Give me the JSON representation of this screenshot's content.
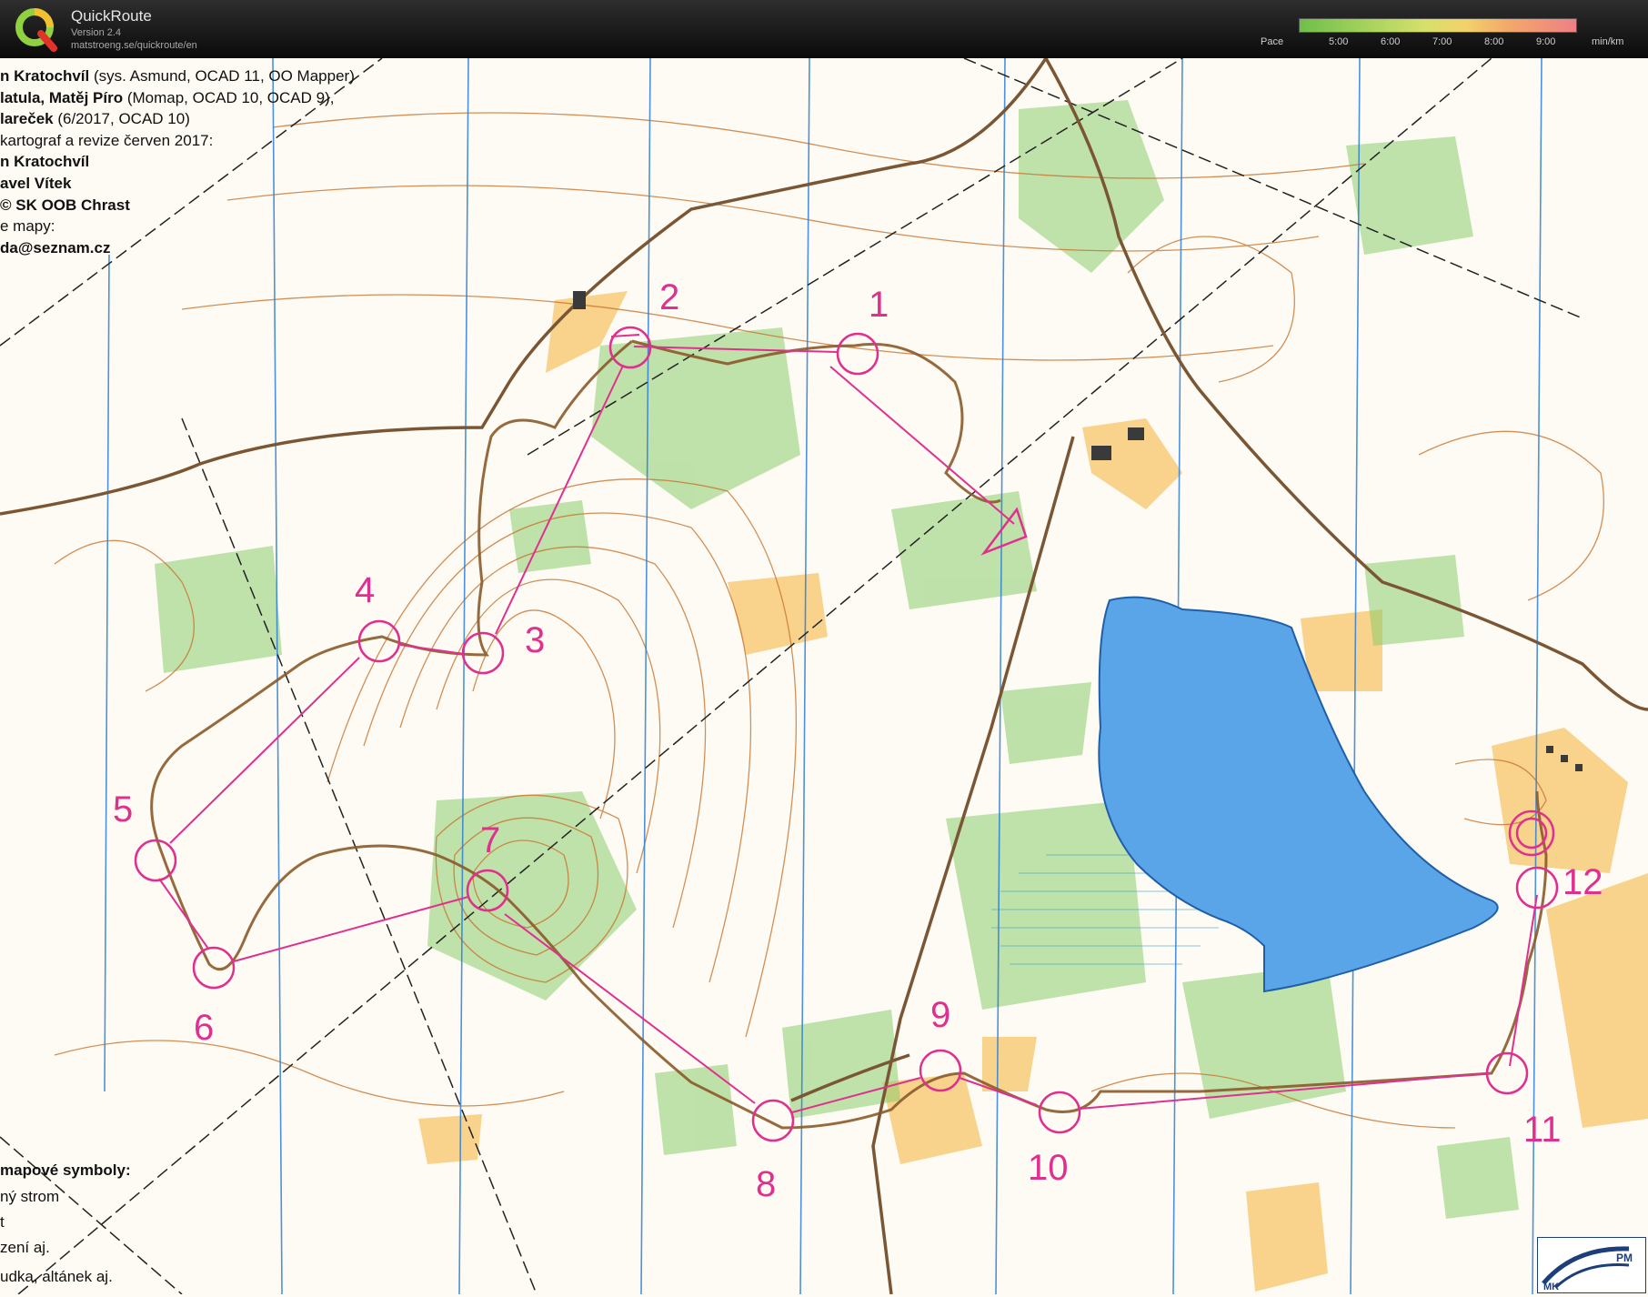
{
  "app": {
    "name": "QuickRoute",
    "version": "Version 2.4",
    "url": "matstroeng.se/quickroute/en"
  },
  "pace_scale": {
    "label": "Pace",
    "ticks": [
      "5:00",
      "6:00",
      "7:00",
      "8:00",
      "9:00"
    ],
    "unit": "min/km",
    "colors": [
      "#6fbf4a",
      "#a7d35d",
      "#d6e06a",
      "#f2d26a",
      "#f3a96a",
      "#ef7f85"
    ]
  },
  "credits": {
    "line1_name": "n Kratochvíl",
    "line1_rest": " (sys. Asmund, OCAD 11, OO  Mapper)",
    "line2_name": "latula, Matěj Píro",
    "line2_rest": " (Momap, OCAD 10, OCAD 9),",
    "line3_name": "lareček",
    "line3_rest": " (6/2017, OCAD 10)",
    "line4": "kartograf a revize červen 2017:",
    "line5": "n Kratochvíl",
    "line6": "avel Vítek",
    "line7": "© SK OOB Chrast",
    "line8": "e mapy:",
    "line9": "da@seznam.cz"
  },
  "legend": {
    "title": "mapové symboly:",
    "items": [
      "ný strom",
      "t",
      "zení aj.",
      "udka, altánek aj."
    ]
  },
  "controls": [
    "1",
    "2",
    "3",
    "4",
    "5",
    "6",
    "7",
    "8",
    "9",
    "10",
    "11",
    "12"
  ],
  "map_logo": {
    "mk": "MK",
    "pm": "PM"
  },
  "colors": {
    "course": "#e0308f",
    "route": "#8a5a2a",
    "water": "#5aa5e8",
    "vegetation": "#8ccc6e",
    "open_land": "#f7c66a",
    "contour": "#c8742e",
    "magnetic_north": "#2e7fd6"
  }
}
